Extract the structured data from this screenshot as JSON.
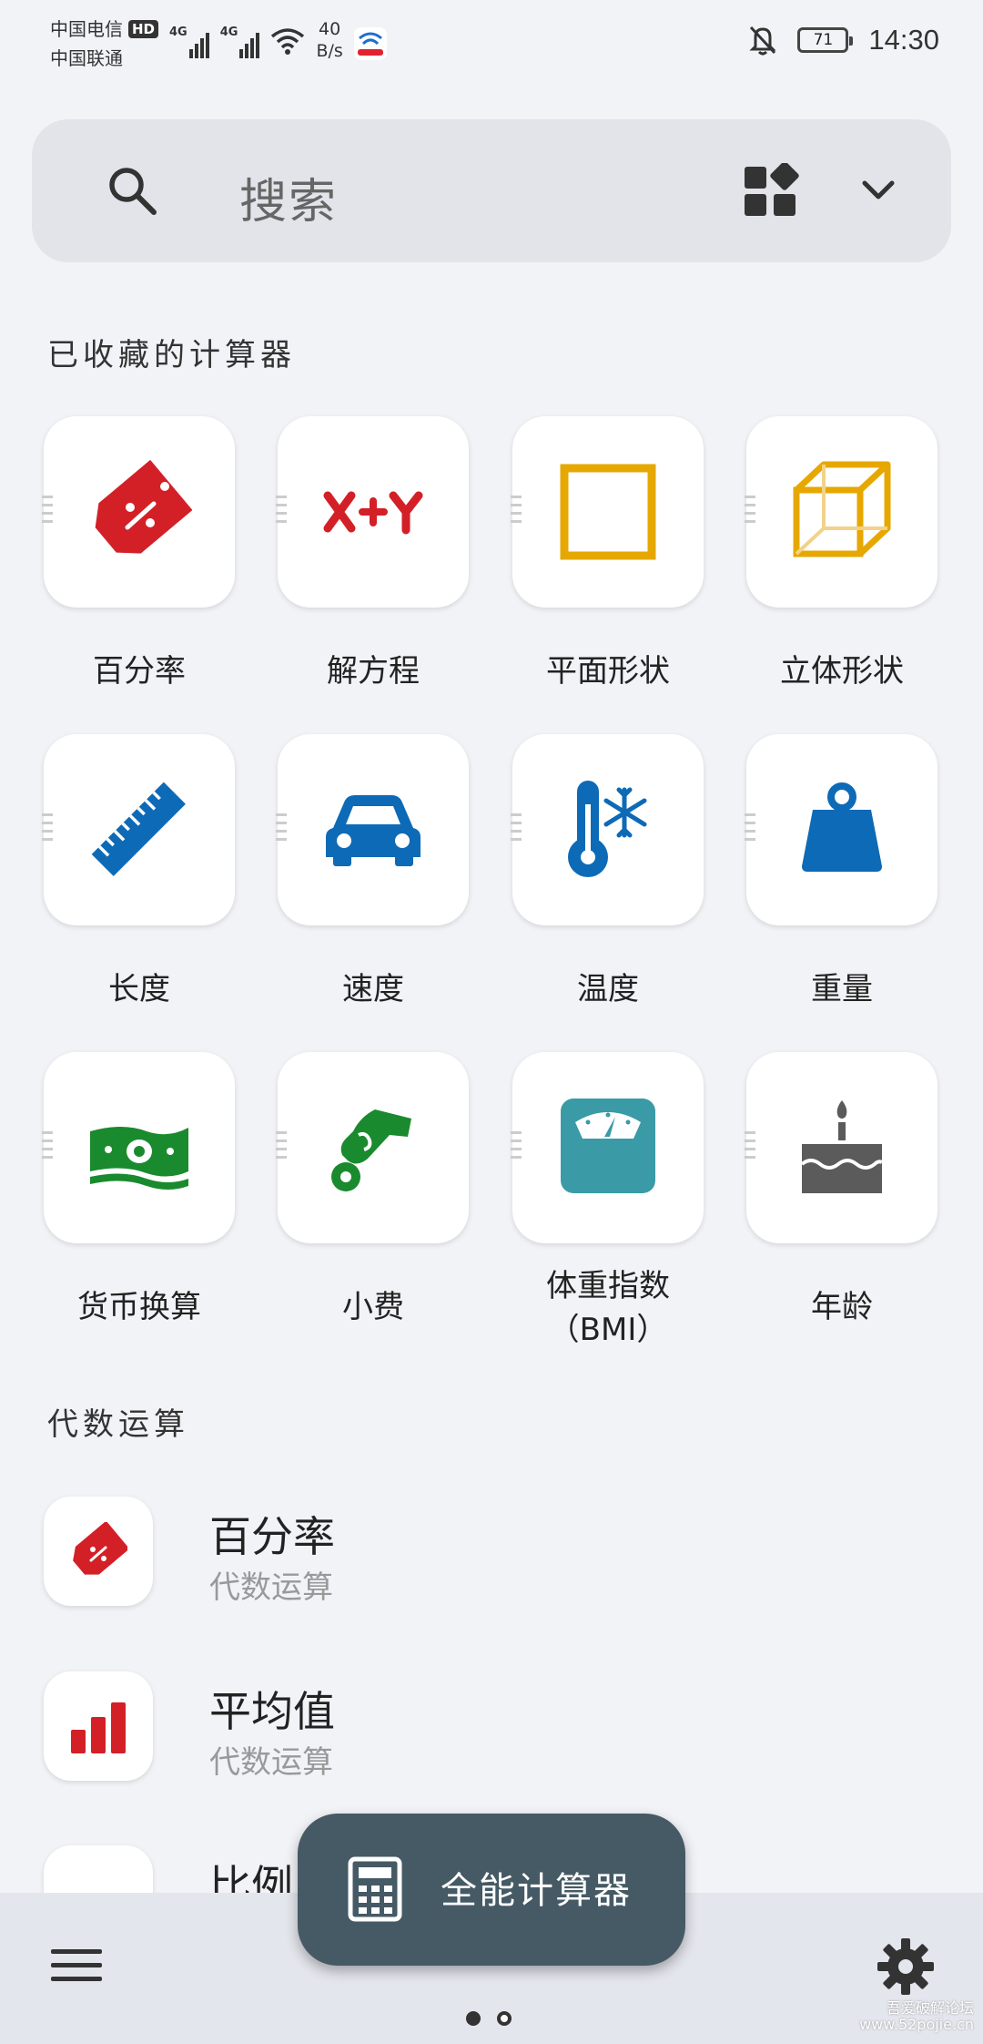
{
  "status_bar": {
    "carrier_1": "中国电信",
    "hd_badge": "HD",
    "carrier_2": "中国联通",
    "network_type_1": "4G",
    "network_type_2": "4G",
    "net_speed_value": "40",
    "net_speed_unit": "B/s",
    "battery_level": "71",
    "time": "14:30",
    "icons": [
      "signal-icon",
      "wifi-icon",
      "telecom-app-icon",
      "mute-bell-icon",
      "battery-icon"
    ]
  },
  "search": {
    "placeholder": "搜索",
    "icons": [
      "search-icon",
      "widgets-icon",
      "chevron-down-icon"
    ]
  },
  "favorites": {
    "title": "已收藏的计算器",
    "items": [
      {
        "label": "百分率",
        "icon": "percent-tag-icon",
        "color": "#d32027"
      },
      {
        "label": "解方程",
        "icon": "x-plus-y-icon",
        "color": "#d32027"
      },
      {
        "label": "平面形状",
        "icon": "square-icon",
        "color": "#e6a800"
      },
      {
        "label": "立体形状",
        "icon": "cube-icon",
        "color": "#e6a800"
      },
      {
        "label": "长度",
        "icon": "ruler-icon",
        "color": "#0d6ab7"
      },
      {
        "label": "速度",
        "icon": "car-icon",
        "color": "#0d6ab7"
      },
      {
        "label": "温度",
        "icon": "thermometer-snowflake-icon",
        "color": "#0d6ab7"
      },
      {
        "label": "重量",
        "icon": "weight-icon",
        "color": "#0d6ab7"
      },
      {
        "label": "货币换算",
        "icon": "money-icon",
        "color": "#1a8a2e"
      },
      {
        "label": "小费",
        "icon": "hand-coin-icon",
        "color": "#1a8a2e"
      },
      {
        "label": "体重指数\n（BMI）",
        "icon": "scale-icon",
        "color": "#3a9aa6"
      },
      {
        "label": "年龄",
        "icon": "cake-icon",
        "color": "#5b5b5b"
      }
    ]
  },
  "algebra": {
    "title": "代数运算",
    "items": [
      {
        "title": "百分率",
        "subtitle": "代数运算",
        "icon": "percent-tag-icon"
      },
      {
        "title": "平均值",
        "subtitle": "代数运算",
        "icon": "bar-chart-icon"
      },
      {
        "title": "比例",
        "subtitle": "",
        "icon": "ratio-icon"
      }
    ]
  },
  "fab": {
    "label": "全能计算器",
    "icon": "calculator-icon"
  },
  "bottom_nav": {
    "icons": [
      "menu-icon",
      "gear-icon"
    ],
    "page_indicator": {
      "pages": 2,
      "current": 1
    },
    "watermark_line1": "吾爱破解论坛",
    "watermark_line2": "www.52pojie.cn"
  }
}
